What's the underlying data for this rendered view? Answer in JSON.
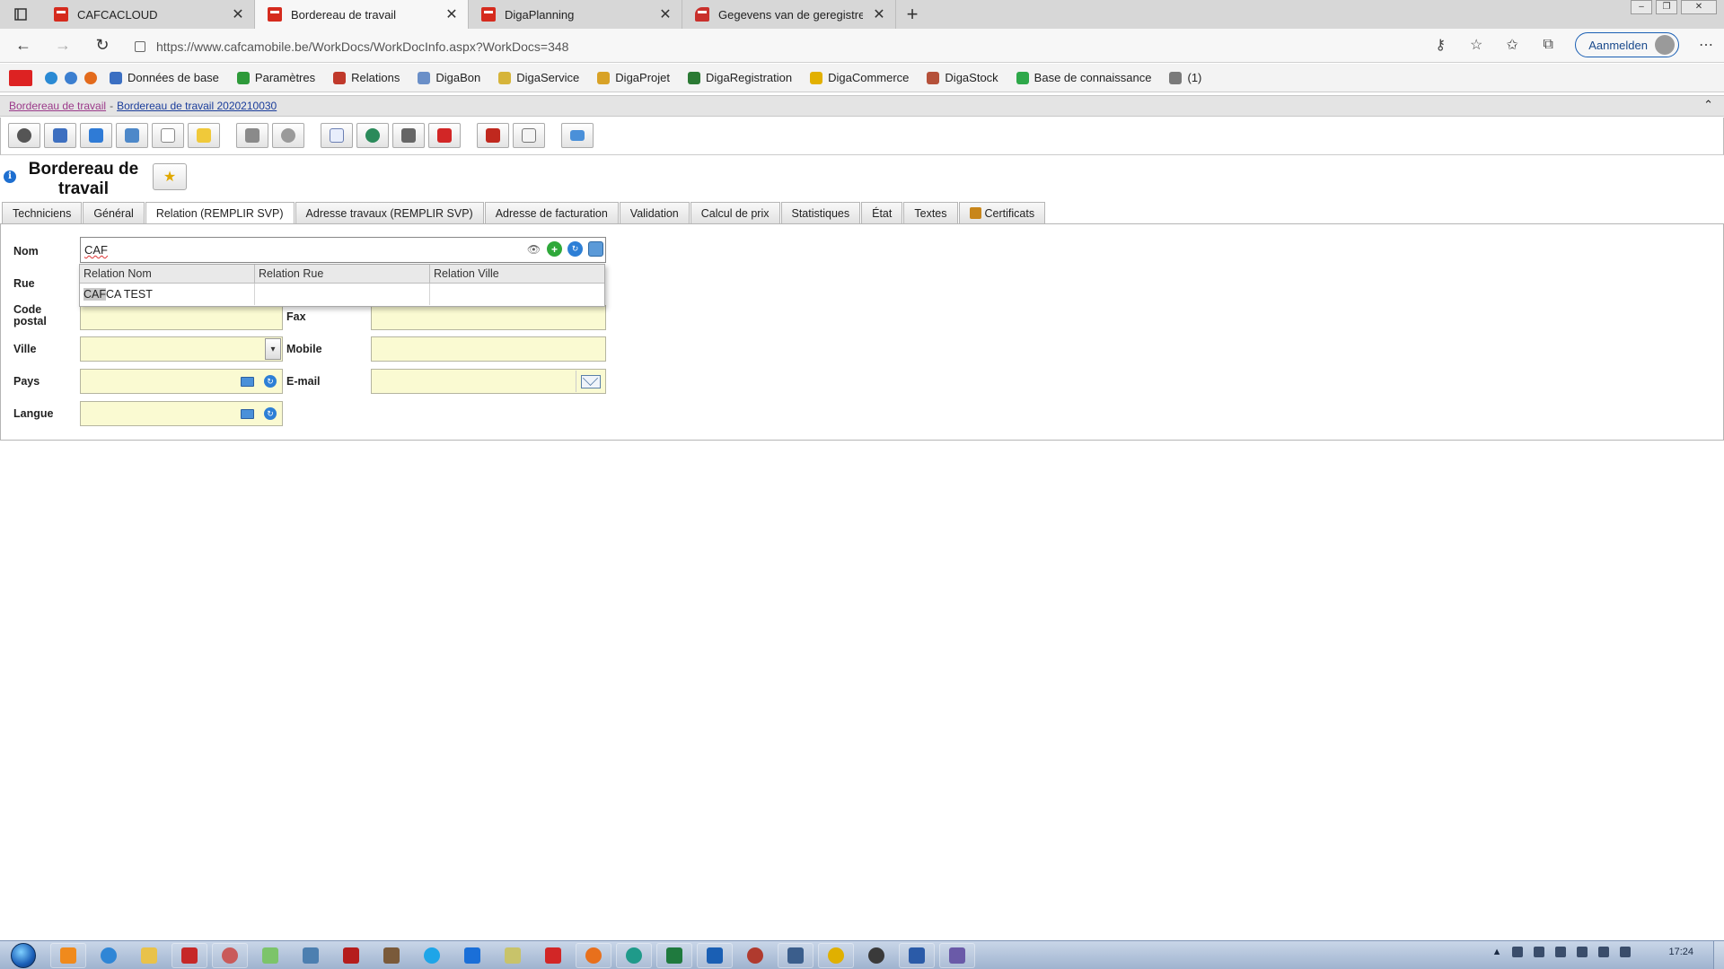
{
  "browser": {
    "tabs": [
      {
        "label": "CAFCACLOUD",
        "active": false
      },
      {
        "label": "Bordereau de travail",
        "active": true
      },
      {
        "label": "DigaPlanning",
        "active": false
      },
      {
        "label": "Gegevens van de geregistreerde",
        "active": false
      }
    ],
    "url": "https://www.cafcamobile.be/WorkDocs/WorkDocInfo.aspx?WorkDocs=348",
    "signin_label": "Aanmelden"
  },
  "menu": {
    "items": [
      {
        "label": "Données de base",
        "color": "#3b6fc2"
      },
      {
        "label": "Paramètres",
        "color": "#2e9a3a"
      },
      {
        "label": "Relations",
        "color": "#c0392b"
      },
      {
        "label": "DigaBon",
        "color": "#6a8fc8"
      },
      {
        "label": "DigaService",
        "color": "#d6b43a"
      },
      {
        "label": "DigaProjet",
        "color": "#d8a227"
      },
      {
        "label": "DigaRegistration",
        "color": "#2b7a34"
      },
      {
        "label": "DigaCommerce",
        "color": "#e2b000"
      },
      {
        "label": "DigaStock",
        "color": "#b5513a"
      },
      {
        "label": "Base de connaissance",
        "color": "#2ea84a"
      },
      {
        "label": "(1)",
        "color": "#7a7a7a"
      }
    ]
  },
  "breadcrumb": {
    "first": "Bordereau de travail",
    "separator": "-",
    "second": "Bordereau de travail 2020210030"
  },
  "page": {
    "title": "Bordereau de travail"
  },
  "page_tabs": [
    {
      "label": "Techniciens",
      "active": false
    },
    {
      "label": "Général",
      "active": false
    },
    {
      "label": "Relation (REMPLIR SVP)",
      "active": true
    },
    {
      "label": "Adresse travaux (REMPLIR SVP)",
      "active": false
    },
    {
      "label": "Adresse de facturation",
      "active": false
    },
    {
      "label": "Validation",
      "active": false
    },
    {
      "label": "Calcul de prix",
      "active": false
    },
    {
      "label": "Statistiques",
      "active": false
    },
    {
      "label": "État",
      "active": false
    },
    {
      "label": "Textes",
      "active": false
    },
    {
      "label": "Certificats",
      "active": false
    }
  ],
  "form": {
    "nom_label": "Nom",
    "nom_value": "CAF",
    "rue_label": "Rue",
    "code_postal_label": "Code postal",
    "ville_label": "Ville",
    "pays_label": "Pays",
    "langue_label": "Langue",
    "fax_label": "Fax",
    "mobile_label": "Mobile",
    "email_label": "E-mail"
  },
  "autocomplete": {
    "columns": [
      "Relation Nom",
      "Relation Rue",
      "Relation Ville"
    ],
    "rows": [
      {
        "match": "CAF",
        "rest": "CA TEST",
        "rue": "",
        "ville": ""
      }
    ]
  },
  "taskbar": {
    "clock": "17:24"
  },
  "colors": {
    "field_bg": "#fafad2",
    "crumb_link": "#1a3d9b",
    "crumb_visited": "#9b3a8a"
  }
}
